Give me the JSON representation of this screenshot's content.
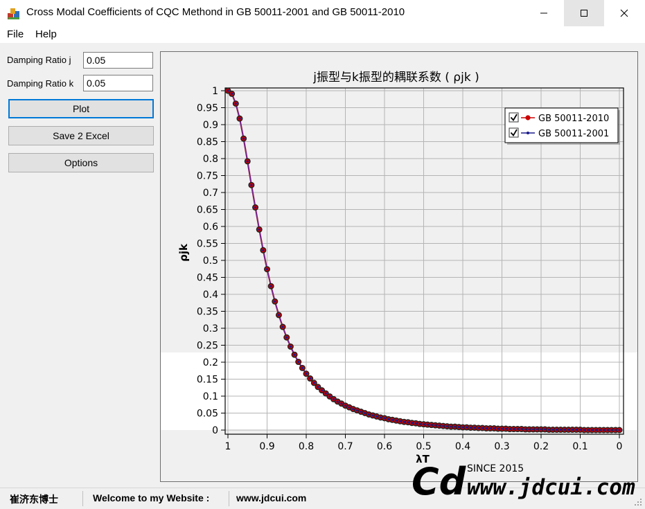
{
  "window": {
    "title": "Cross Modal Coefficients of CQC Methond in GB 50011-2001 and GB 50011-2010"
  },
  "menu": {
    "items": [
      "File",
      "Help"
    ]
  },
  "form": {
    "damping_j_label": "Damping Ratio j",
    "damping_j_value": "0.05",
    "damping_k_label": "Damping Ratio k",
    "damping_k_value": "0.05",
    "plot_label": "Plot",
    "save_label": "Save 2 Excel",
    "options_label": "Options"
  },
  "statusbar": {
    "author": "崔济东博士",
    "welcome": "Welcome to my Website :",
    "website": "www.jdcui.com"
  },
  "logo": {
    "mark": "Cd",
    "since": "SINCE 2015",
    "url": "www.jdcui.com"
  },
  "colors": {
    "series_2010": "#cc0000",
    "series_2001": "#1a1a8c",
    "accent": "#0078d7"
  },
  "chart_data": {
    "type": "line",
    "title": "j振型与k振型的耦联系数 ( ρjk )",
    "xlabel": "λT",
    "ylabel": "ρjk",
    "xlim": [
      1,
      0
    ],
    "ylim": [
      0,
      1
    ],
    "xticks": [
      "1",
      "0.9",
      "0.8",
      "0.7",
      "0.6",
      "0.5",
      "0.4",
      "0.3",
      "0.2",
      "0.1",
      "0"
    ],
    "yticks": [
      "0",
      "0.05",
      "0.1",
      "0.15",
      "0.2",
      "0.25",
      "0.3",
      "0.35",
      "0.4",
      "0.45",
      "0.5",
      "0.55",
      "0.6",
      "0.65",
      "0.7",
      "0.75",
      "0.8",
      "0.85",
      "0.9",
      "0.95",
      "1"
    ],
    "grid": true,
    "legend": "top-right",
    "x": [
      1.0,
      0.99,
      0.98,
      0.97,
      0.96,
      0.95,
      0.94,
      0.93,
      0.92,
      0.91,
      0.9,
      0.89,
      0.88,
      0.87,
      0.86,
      0.85,
      0.84,
      0.83,
      0.82,
      0.81,
      0.8,
      0.79,
      0.78,
      0.77,
      0.76,
      0.75,
      0.74,
      0.73,
      0.72,
      0.71,
      0.7,
      0.69,
      0.68,
      0.67,
      0.66,
      0.65,
      0.64,
      0.63,
      0.62,
      0.61,
      0.6,
      0.59,
      0.58,
      0.57,
      0.56,
      0.55,
      0.54,
      0.53,
      0.52,
      0.51,
      0.5,
      0.49,
      0.48,
      0.47,
      0.46,
      0.45,
      0.44,
      0.43,
      0.42,
      0.41,
      0.4,
      0.39,
      0.38,
      0.37,
      0.36,
      0.35,
      0.34,
      0.33,
      0.32,
      0.31,
      0.3,
      0.29,
      0.28,
      0.27,
      0.26,
      0.25,
      0.24,
      0.23,
      0.22,
      0.21,
      0.2,
      0.19,
      0.18,
      0.17,
      0.16,
      0.15,
      0.14,
      0.13,
      0.12,
      0.11,
      0.1,
      0.09,
      0.08,
      0.07,
      0.06,
      0.05,
      0.04,
      0.03,
      0.02,
      0.01,
      0.0
    ],
    "series": [
      {
        "name": "GB 50011-2010",
        "values": [
          1.0,
          0.991,
          0.962,
          0.918,
          0.859,
          0.792,
          0.722,
          0.656,
          0.591,
          0.53,
          0.474,
          0.424,
          0.379,
          0.339,
          0.304,
          0.273,
          0.246,
          0.222,
          0.201,
          0.183,
          0.166,
          0.152,
          0.139,
          0.127,
          0.117,
          0.108,
          0.099,
          0.091,
          0.084,
          0.078,
          0.072,
          0.067,
          0.062,
          0.058,
          0.054,
          0.05,
          0.046,
          0.043,
          0.04,
          0.037,
          0.035,
          0.032,
          0.03,
          0.028,
          0.026,
          0.024,
          0.023,
          0.021,
          0.02,
          0.018,
          0.017,
          0.016,
          0.015,
          0.014,
          0.013,
          0.012,
          0.011,
          0.01,
          0.01,
          0.009,
          0.008,
          0.008,
          0.007,
          0.007,
          0.006,
          0.006,
          0.005,
          0.005,
          0.005,
          0.004,
          0.004,
          0.004,
          0.003,
          0.003,
          0.003,
          0.003,
          0.002,
          0.002,
          0.002,
          0.002,
          0.002,
          0.002,
          0.001,
          0.001,
          0.001,
          0.001,
          0.001,
          0.001,
          0.001,
          0.001,
          0.001,
          0.0,
          0.0,
          0.0,
          0.0,
          0.0,
          0.0,
          0.0,
          0.0,
          0.0,
          0.0
        ]
      },
      {
        "name": "GB 50011-2001",
        "values": [
          1.0,
          0.991,
          0.962,
          0.918,
          0.859,
          0.792,
          0.722,
          0.656,
          0.591,
          0.53,
          0.474,
          0.424,
          0.379,
          0.339,
          0.304,
          0.273,
          0.246,
          0.222,
          0.201,
          0.183,
          0.166,
          0.152,
          0.139,
          0.127,
          0.117,
          0.108,
          0.099,
          0.091,
          0.084,
          0.078,
          0.072,
          0.067,
          0.062,
          0.058,
          0.054,
          0.05,
          0.046,
          0.043,
          0.04,
          0.037,
          0.035,
          0.032,
          0.03,
          0.028,
          0.026,
          0.024,
          0.023,
          0.021,
          0.02,
          0.018,
          0.017,
          0.016,
          0.015,
          0.014,
          0.013,
          0.012,
          0.011,
          0.01,
          0.01,
          0.009,
          0.008,
          0.008,
          0.007,
          0.007,
          0.006,
          0.006,
          0.005,
          0.005,
          0.005,
          0.004,
          0.004,
          0.004,
          0.003,
          0.003,
          0.003,
          0.003,
          0.002,
          0.002,
          0.002,
          0.002,
          0.002,
          0.002,
          0.001,
          0.001,
          0.001,
          0.001,
          0.001,
          0.001,
          0.001,
          0.001,
          0.001,
          0.0,
          0.0,
          0.0,
          0.0,
          0.0,
          0.0,
          0.0,
          0.0,
          0.0,
          0.0
        ]
      }
    ]
  }
}
